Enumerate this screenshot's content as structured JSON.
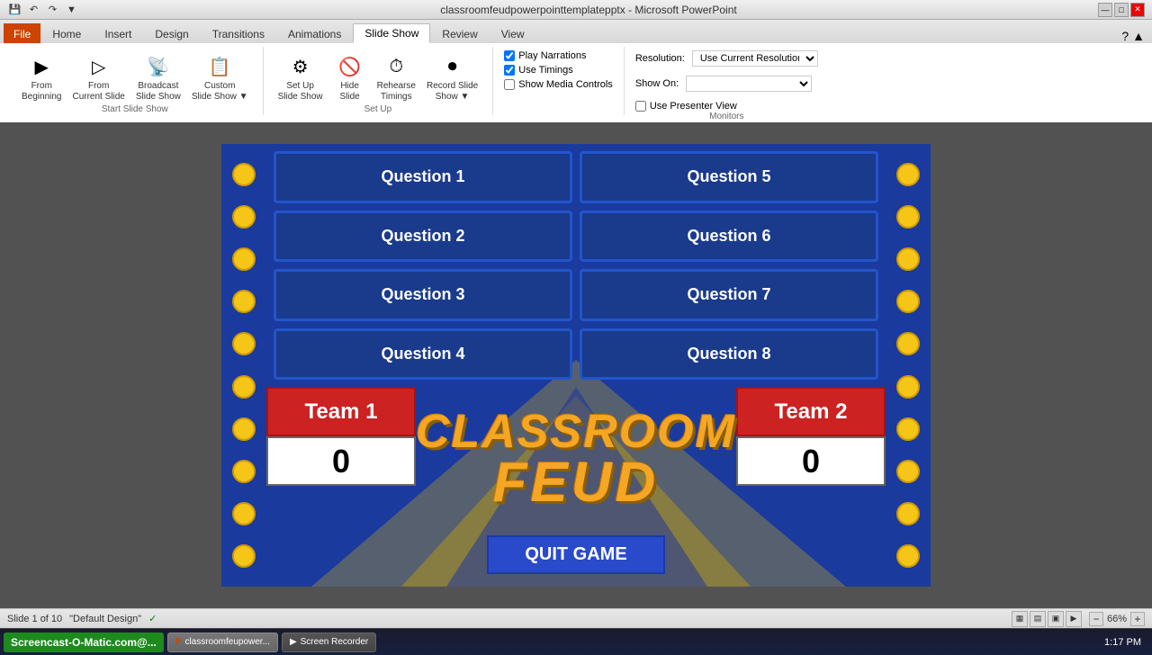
{
  "titleBar": {
    "title": "classroomfeudpowerpointtemplatepptx - Microsoft PowerPoint",
    "minBtn": "—",
    "maxBtn": "□",
    "closeBtn": "✕"
  },
  "quickAccess": {
    "save": "💾",
    "undo": "↶",
    "redo": "↷"
  },
  "ribbonTabs": [
    {
      "id": "file",
      "label": "File",
      "active": false,
      "file": true
    },
    {
      "id": "home",
      "label": "Home",
      "active": false
    },
    {
      "id": "insert",
      "label": "Insert",
      "active": false
    },
    {
      "id": "design",
      "label": "Design",
      "active": false
    },
    {
      "id": "transitions",
      "label": "Transitions",
      "active": false
    },
    {
      "id": "animations",
      "label": "Animations",
      "active": false
    },
    {
      "id": "slideshow",
      "label": "Slide Show",
      "active": true
    },
    {
      "id": "review",
      "label": "Review",
      "active": false
    },
    {
      "id": "view",
      "label": "View",
      "active": false
    }
  ],
  "ribbon": {
    "startSlideShow": {
      "fromBeginning": "From\nBeginning",
      "fromCurrentSlide": "From\nCurrent Slide",
      "broadcastSlideShow": "Broadcast\nSlide Show",
      "customSlideShow": "Custom\nSlide Show"
    },
    "setUp": {
      "setUpSlideShow": "Set Up\nSlide Show",
      "hideSlide": "Hide\nSlide",
      "rehearseTimings": "Rehearse\nTimings",
      "recordSlideShow": "Record Slide\nShow"
    },
    "playNarrations": "Play Narrations",
    "useTimings": "Use Timings",
    "showMediaControls": "Show Media Controls",
    "resolution": "Resolution:",
    "resolutionValue": "Use Current Resolution",
    "showOn": "Show On:",
    "showOnValue": "",
    "usePresenterView": "Use Presenter View",
    "groupLabels": {
      "startSlideShow": "Start Slide Show",
      "setUp": "Set Up",
      "monitors": "Monitors"
    }
  },
  "slide": {
    "background": "#1a3a9e",
    "questions": [
      {
        "id": 1,
        "label": "Question 1"
      },
      {
        "id": 2,
        "label": "Question 2"
      },
      {
        "id": 3,
        "label": "Question 3"
      },
      {
        "id": 4,
        "label": "Question 4"
      },
      {
        "id": 5,
        "label": "Question 5"
      },
      {
        "id": 6,
        "label": "Question 6"
      },
      {
        "id": 7,
        "label": "Question 7"
      },
      {
        "id": 8,
        "label": "Question 8"
      }
    ],
    "titleLine1": "CLASSROOM",
    "titleLine2": "FEUD",
    "team1": {
      "name": "Team 1",
      "score": "0"
    },
    "team2": {
      "name": "Team 2",
      "score": "0"
    },
    "quitButton": "QUIT GAME"
  },
  "statusBar": {
    "slideInfo": "Slide 1 of 10",
    "theme": "\"Default Design\"",
    "checkmark": "✓",
    "zoom": "66%",
    "viewNormal": "▦",
    "viewSlide": "▤",
    "viewReading": "▣",
    "viewSlideshow": "▶"
  },
  "taskbar": {
    "startLabel": "Screencast-O-Matic.com@...",
    "items": [
      {
        "label": "classroomfeupower...",
        "icon": "P",
        "active": true
      },
      {
        "label": "Screen Recorder",
        "icon": "▶"
      }
    ],
    "time": "1:17 PM"
  }
}
